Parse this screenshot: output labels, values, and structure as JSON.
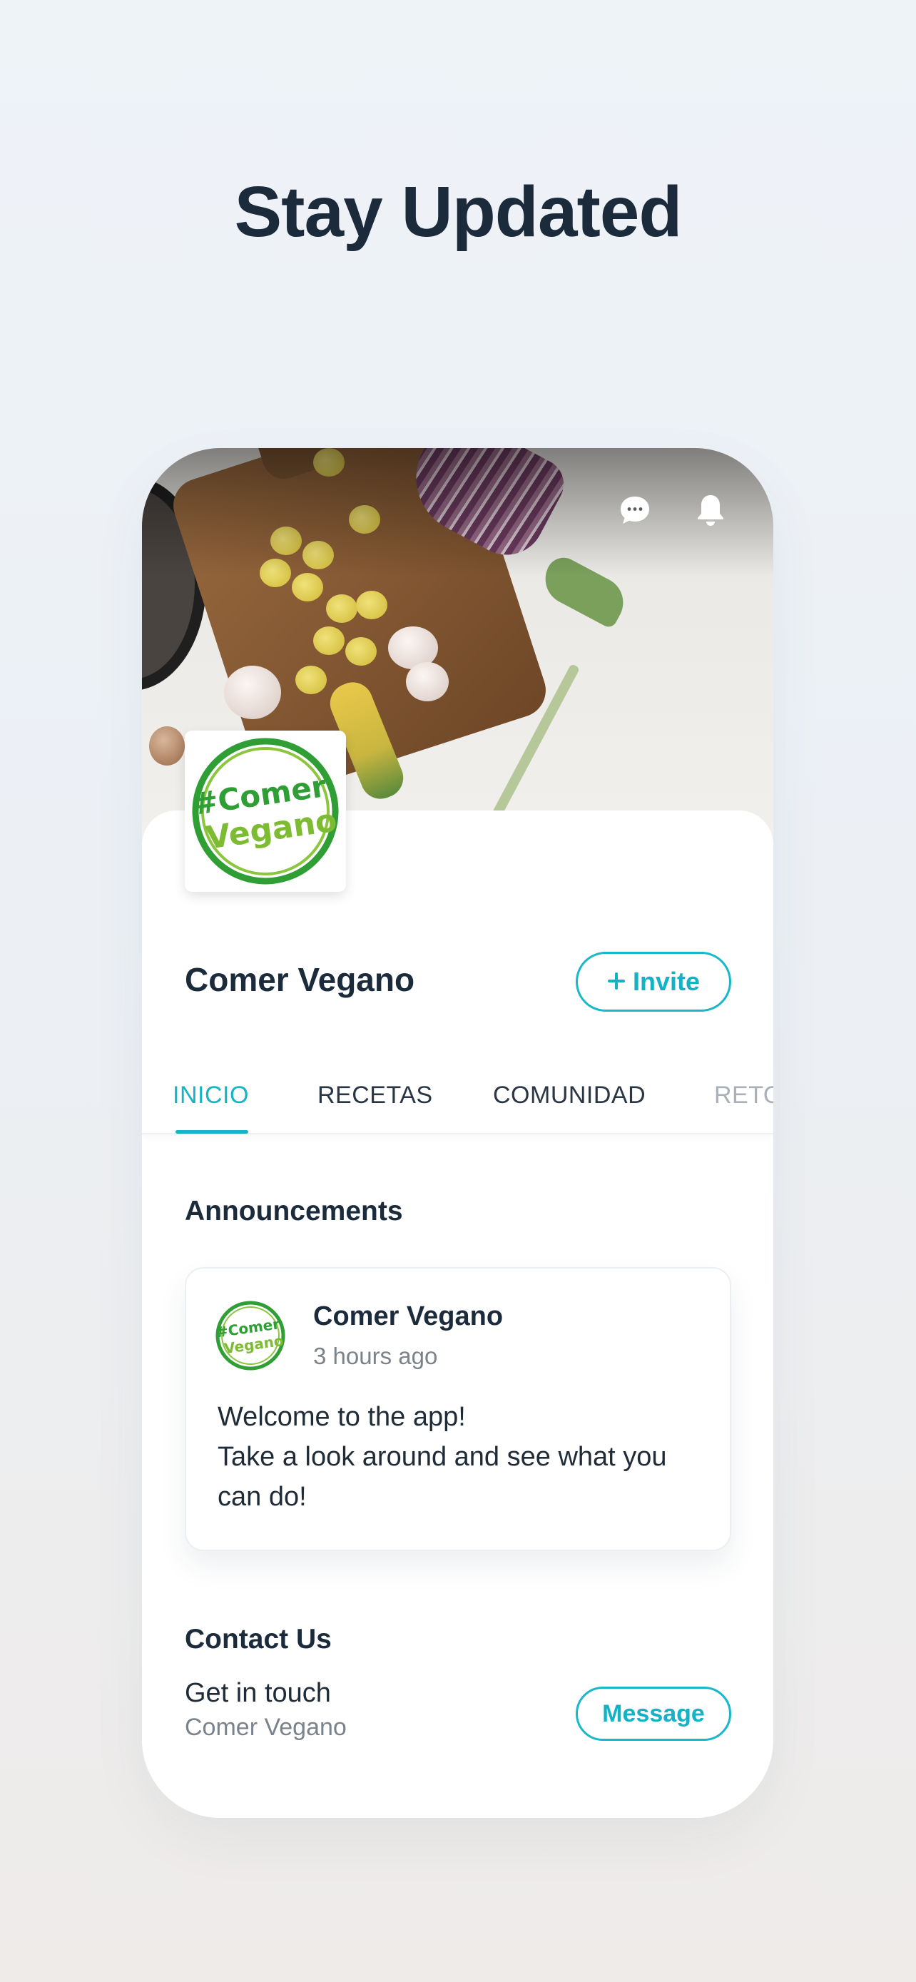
{
  "headline": "Stay Updated",
  "header": {
    "chat_icon": "chat-bubble-icon",
    "bell_icon": "bell-icon"
  },
  "group": {
    "name": "Comer Vegano",
    "logo_text_line1": "#Comer",
    "logo_text_line2": "Vegano",
    "invite_label": "Invite",
    "invite_icon": "plus-icon"
  },
  "tabs": [
    {
      "label": "INICIO",
      "active": true
    },
    {
      "label": "RECETAS",
      "active": false
    },
    {
      "label": "COMUNIDAD",
      "active": false
    },
    {
      "label": "RETO",
      "active": false
    }
  ],
  "announcements": {
    "title": "Announcements",
    "post": {
      "author": "Comer Vegano",
      "time": "3 hours ago",
      "lines": [
        "Welcome to the app!",
        "Take a look around and see what you",
        "can do!"
      ]
    }
  },
  "contact": {
    "title": "Contact Us",
    "main": "Get in touch",
    "sub": "Comer Vegano",
    "button_label": "Message"
  },
  "colors": {
    "accent": "#16b4c6",
    "text_dark": "#1b2b3c",
    "logo_green": "#3aa82c",
    "logo_lime": "#8cc63f"
  }
}
